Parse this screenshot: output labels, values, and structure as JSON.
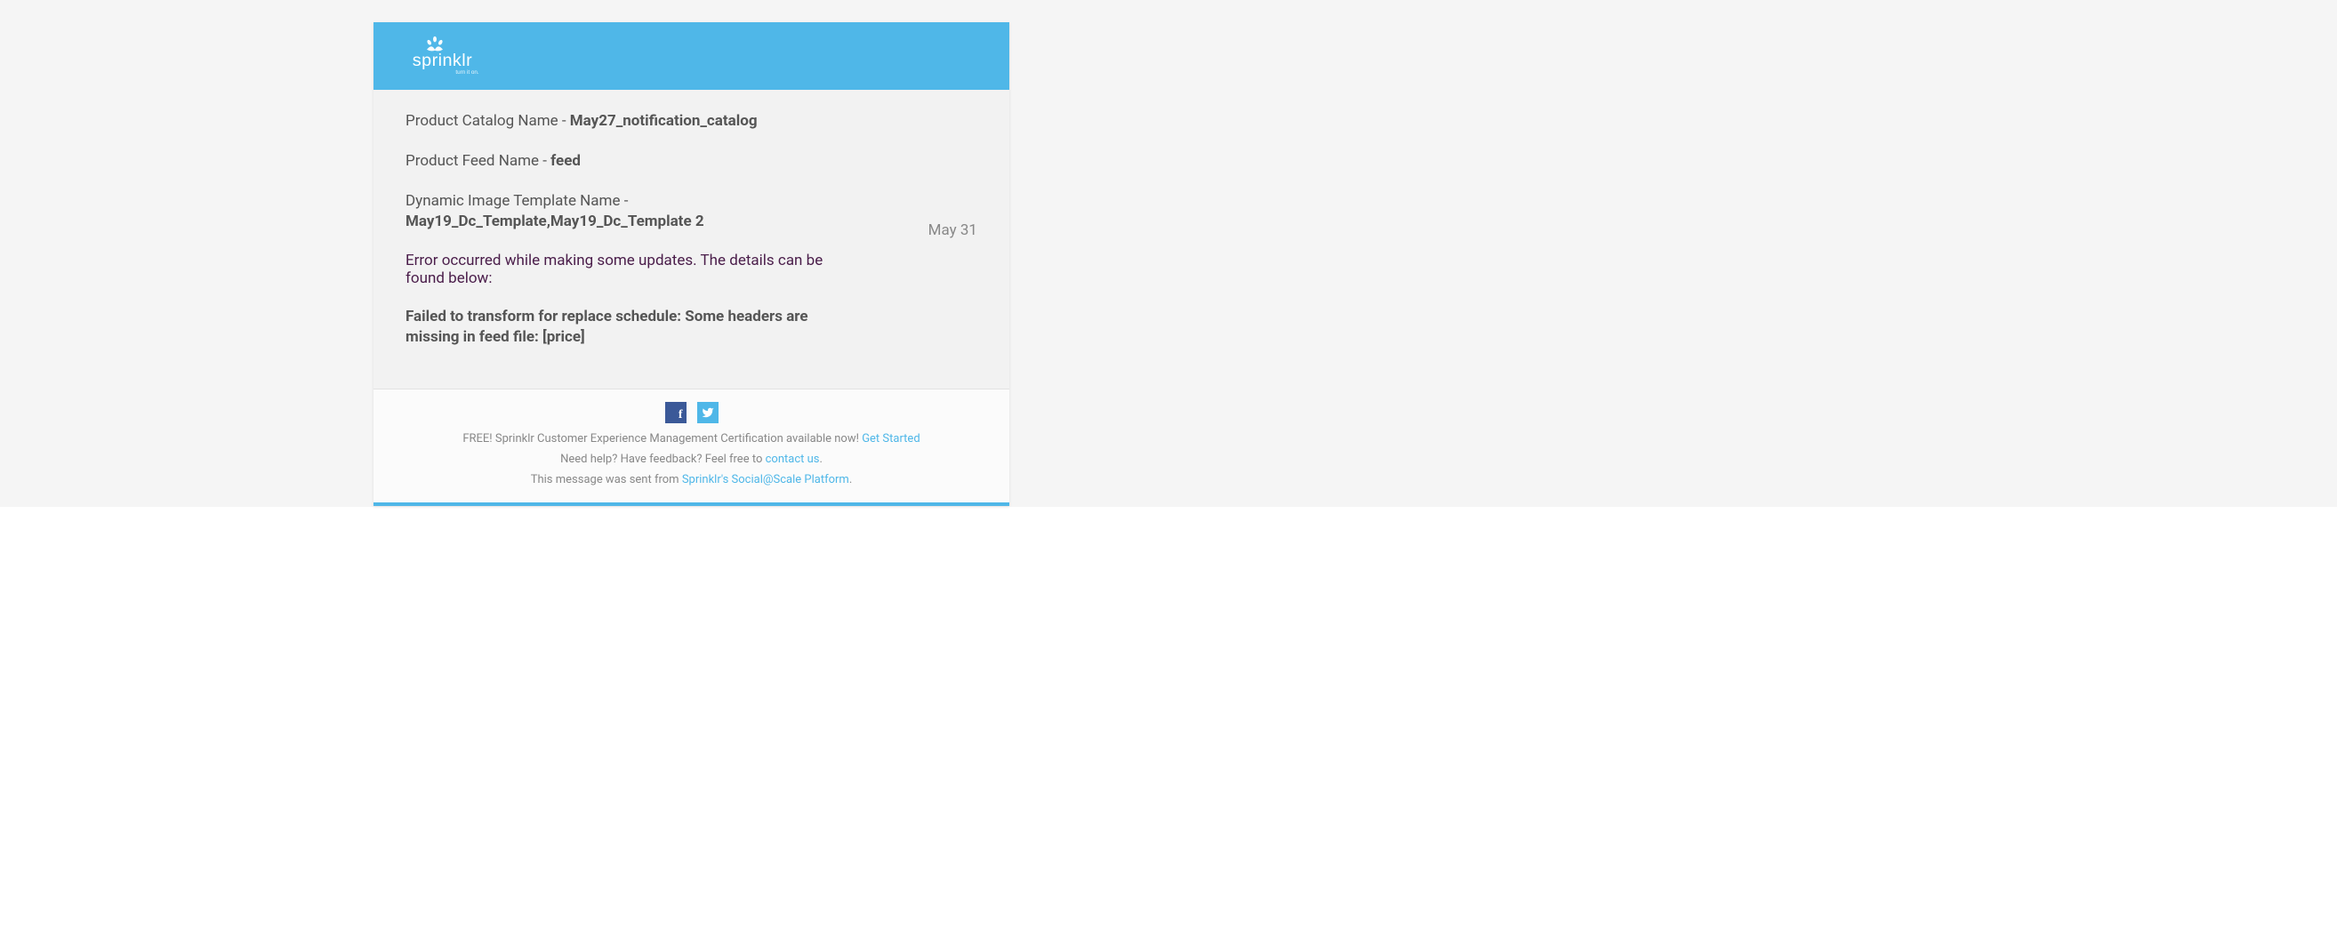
{
  "brand": {
    "name": "sprinklr",
    "tagline": "turn it on."
  },
  "content": {
    "catalog": {
      "label": "Product Catalog Name - ",
      "value": "May27_notification_catalog"
    },
    "feed": {
      "label": "Product Feed Name - ",
      "value": "feed"
    },
    "template": {
      "label": "Dynamic Image Template Name - ",
      "value": "May19_Dc_Template,May19_Dc_Template 2"
    },
    "error_heading": "Error occurred while making some updates. The details can be found below:",
    "failure": "Failed to transform for replace schedule: Some headers are missing in feed file: [price]",
    "date": "May 31"
  },
  "footer": {
    "line1_text": "FREE! Sprinklr Customer Experience Management Certification available now! ",
    "line1_link": "Get Started",
    "line2_text": "Need help? Have feedback? Feel free to ",
    "line2_link": "contact us",
    "line2_tail": ".",
    "line3_text": "This message was sent from ",
    "line3_link": "Sprinklr's Social@Scale Platform",
    "line3_tail": "."
  }
}
